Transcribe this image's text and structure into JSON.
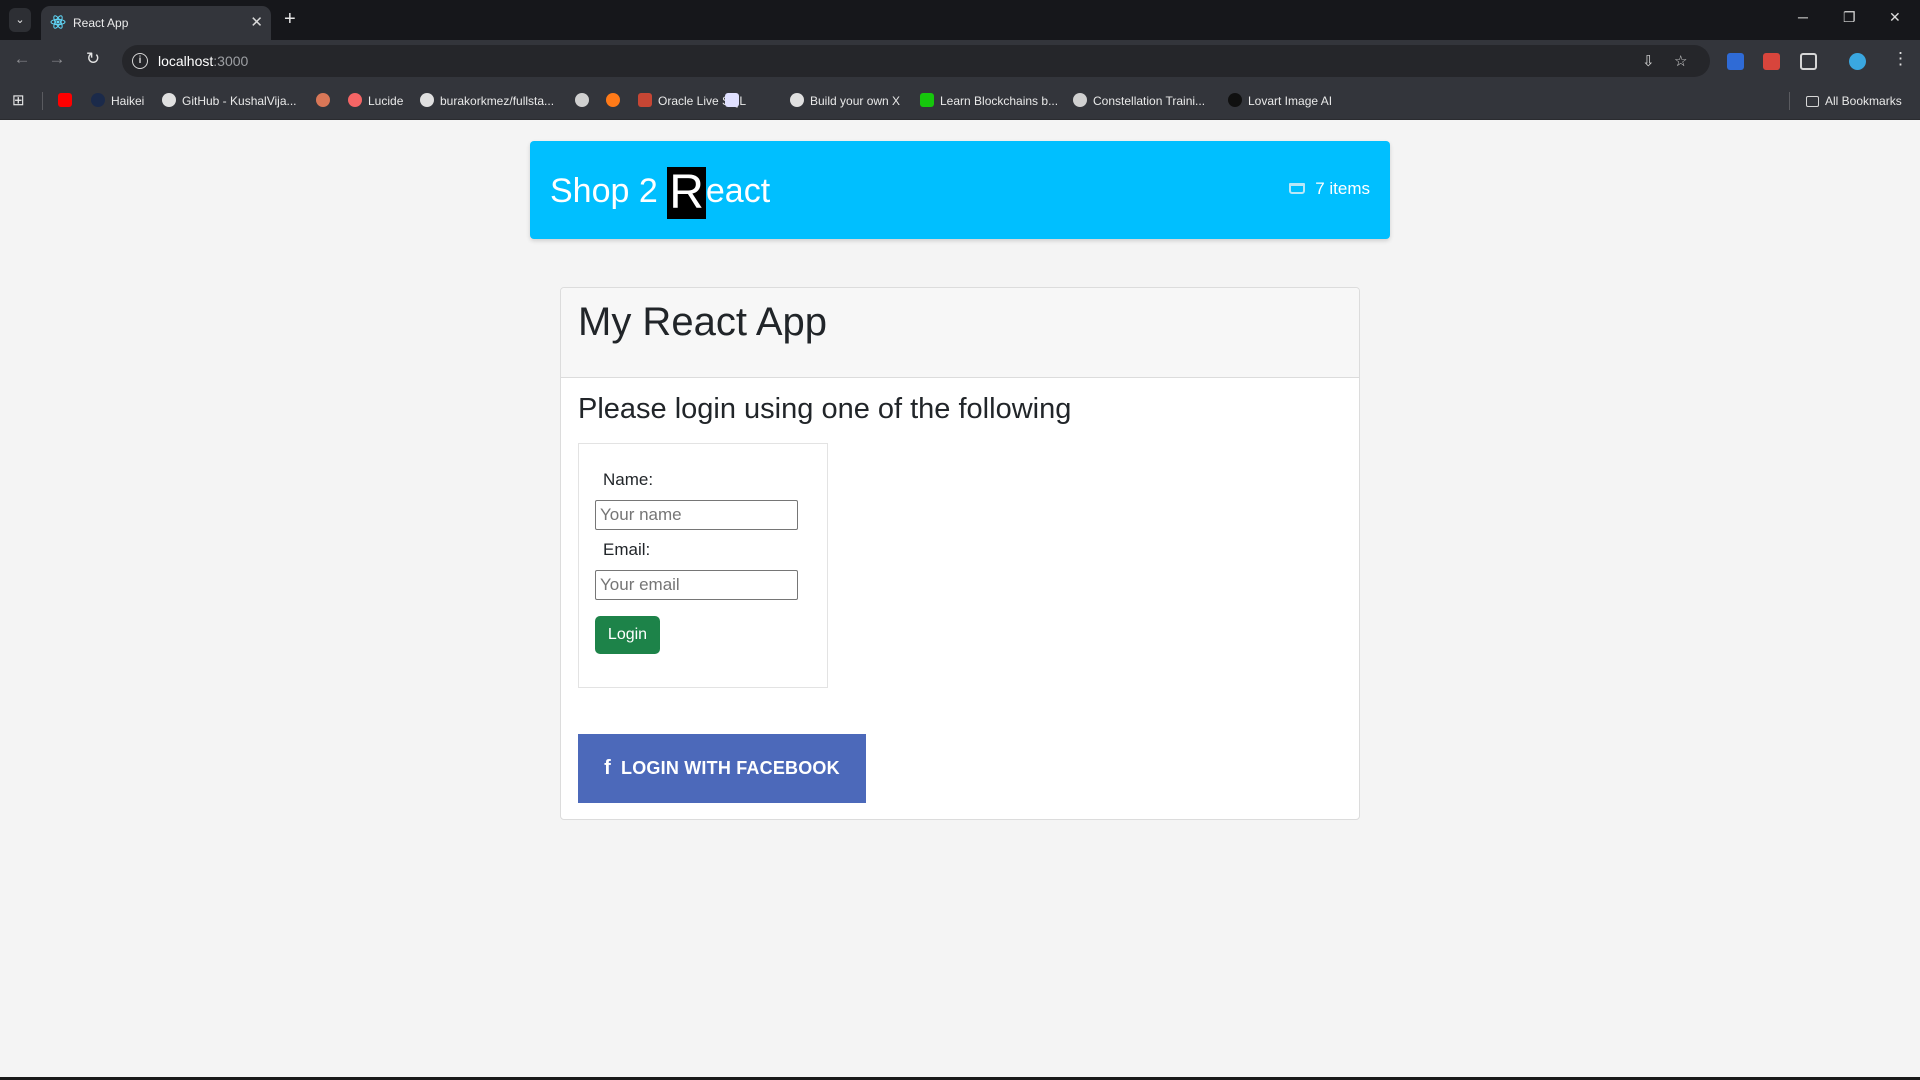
{
  "browser": {
    "tab": {
      "title": "React App",
      "close_glyph": "✕"
    },
    "tab_search_glyph": "⌄",
    "new_tab_glyph": "+",
    "window_controls": {
      "minimize": "─",
      "restore": "❐",
      "close": "✕"
    },
    "nav": {
      "back": "←",
      "forward": "→",
      "reload": "↻"
    },
    "address": {
      "host": "localhost",
      "port": ":3000",
      "info_glyph": "i"
    },
    "omnibox_icons": {
      "install": "⇩",
      "bookmark_star": "☆"
    },
    "menu_glyph": "⋮",
    "apps_glyph": "⊞",
    "bookmarks": [
      {
        "label": "",
        "icon": "youtube-icon",
        "color": "#ff0000"
      },
      {
        "label": "Haikei",
        "icon": "haikei-icon",
        "color": "#1b2a4a"
      },
      {
        "label": "GitHub - KushalVija...",
        "icon": "github-icon",
        "color": "#e0e0e0"
      },
      {
        "label": "",
        "icon": "asterisk-icon",
        "color": "#d97757"
      },
      {
        "label": "Lucide",
        "icon": "lucide-icon",
        "color": "#f56565"
      },
      {
        "label": "burakorkmez/fullsta...",
        "icon": "github-icon",
        "color": "#e0e0e0"
      },
      {
        "label": "",
        "icon": "openai-icon",
        "color": "#d0d0d0"
      },
      {
        "label": "",
        "icon": "h-icon",
        "color": "#ff7a18"
      },
      {
        "label": "Oracle Live SQL",
        "icon": "oracle-icon",
        "color": "#c74634"
      },
      {
        "label": "",
        "icon": "x-logo-icon",
        "color": "#e0e0ff"
      },
      {
        "label": "Build your own X",
        "icon": "github-icon",
        "color": "#e0e0e0"
      },
      {
        "label": "Learn Blockchains b...",
        "icon": "blockchain-icon",
        "color": "#16c60c"
      },
      {
        "label": "Constellation Traini...",
        "icon": "globe-icon",
        "color": "#d0d0d0"
      },
      {
        "label": "Lovart Image AI",
        "icon": "lovart-icon",
        "color": "#101010"
      }
    ],
    "all_bookmarks": "All Bookmarks"
  },
  "header": {
    "brand_prefix": "Shop 2 ",
    "brand_r": "R",
    "brand_suffix": "eact",
    "cart_label": "7 items",
    "accent": "#00bfff"
  },
  "card": {
    "title": "My React App",
    "subtitle": "Please login using one of the following"
  },
  "form": {
    "name_label": "Name:",
    "name_placeholder": "Your name",
    "email_label": "Email:",
    "email_placeholder": "Your email",
    "login_button": "Login",
    "login_color": "#1d8349"
  },
  "facebook": {
    "icon_glyph": "f",
    "label": "LOGIN WITH FACEBOOK",
    "color": "#4c69ba"
  }
}
